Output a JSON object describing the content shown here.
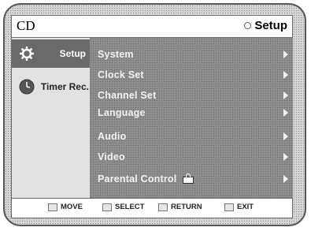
{
  "header": {
    "mode": "CD",
    "current_menu": "Setup"
  },
  "sidebar": {
    "items": [
      {
        "label": "Setup",
        "icon": "gear-icon",
        "active": true
      },
      {
        "label": "Timer Rec.",
        "icon": "clock-icon",
        "active": false
      }
    ]
  },
  "menu": {
    "items": [
      {
        "label": "System"
      },
      {
        "label": "Clock Set"
      },
      {
        "label": "Channel Set"
      },
      {
        "label": "Language"
      },
      {
        "label": "Audio"
      },
      {
        "label": "Video"
      },
      {
        "label": "Parental Control"
      }
    ]
  },
  "footer": {
    "hints": [
      {
        "label": "MOVE"
      },
      {
        "label": "SELECT"
      },
      {
        "label": "RETURN"
      },
      {
        "label": "EXIT"
      }
    ]
  },
  "colors": {
    "panel_bg": "#8e8e8e",
    "active_tab": "#6a6a6a",
    "text_light": "#f2f2f2"
  }
}
